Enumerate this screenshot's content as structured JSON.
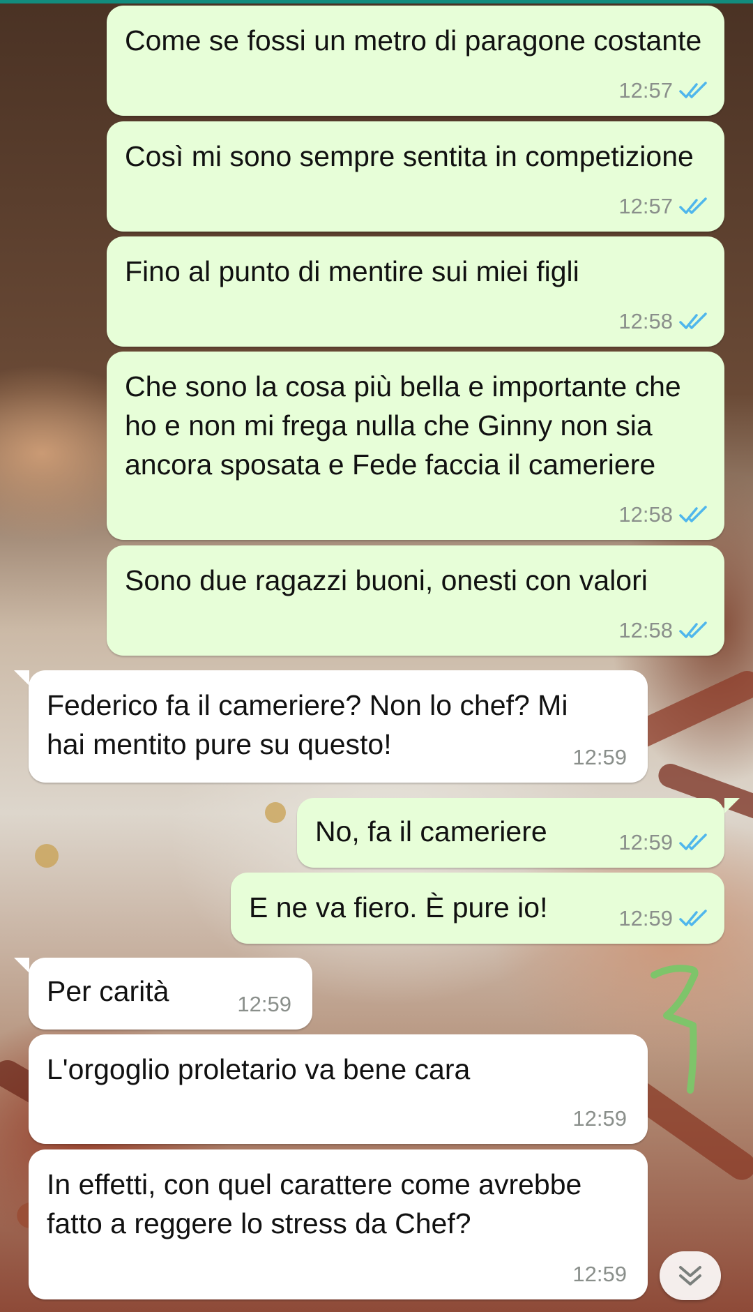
{
  "chat": {
    "messages": [
      {
        "direction": "outgoing",
        "text": "Come se fossi un metro di paragone costante",
        "time": "12:57",
        "status": "read"
      },
      {
        "direction": "outgoing",
        "text": "Così mi sono sempre sentita in competizione",
        "time": "12:57",
        "status": "read"
      },
      {
        "direction": "outgoing",
        "text": "Fino al punto di mentire sui miei figli",
        "time": "12:58",
        "status": "read"
      },
      {
        "direction": "outgoing",
        "text": "Che sono la cosa più bella e importante che ho e non mi frega nulla che Ginny non sia ancora sposata e Fede faccia il cameriere",
        "time": "12:58",
        "status": "read"
      },
      {
        "direction": "outgoing",
        "text": "Sono due ragazzi buoni, onesti con valori",
        "time": "12:58",
        "status": "read"
      },
      {
        "direction": "incoming",
        "text": "Federico fa il cameriere? Non lo chef? Mi hai mentito pure su questo!",
        "time": "12:59"
      },
      {
        "direction": "outgoing",
        "text": "No, fa il cameriere",
        "time": "12:59",
        "status": "read"
      },
      {
        "direction": "outgoing",
        "text": "E ne va fiero. È pure io!",
        "time": "12:59",
        "status": "read"
      },
      {
        "direction": "incoming",
        "text": "Per carità",
        "time": "12:59"
      },
      {
        "direction": "incoming",
        "text": "L'orgoglio proletario va bene cara",
        "time": "12:59"
      },
      {
        "direction": "incoming",
        "text": "In effetti, con quel carattere come avrebbe fatto a reggere lo stress da Chef?",
        "time": "12:59"
      }
    ]
  },
  "colors": {
    "outgoing_bubble": "#e7fed8",
    "incoming_bubble": "#ffffff",
    "read_ticks": "#4fb6ec",
    "timestamp": "#8a8f8b",
    "annotation": "#7ec46a"
  },
  "icons": {
    "read_receipt": "double-check-icon",
    "scroll_down": "chevron-double-down-icon"
  }
}
